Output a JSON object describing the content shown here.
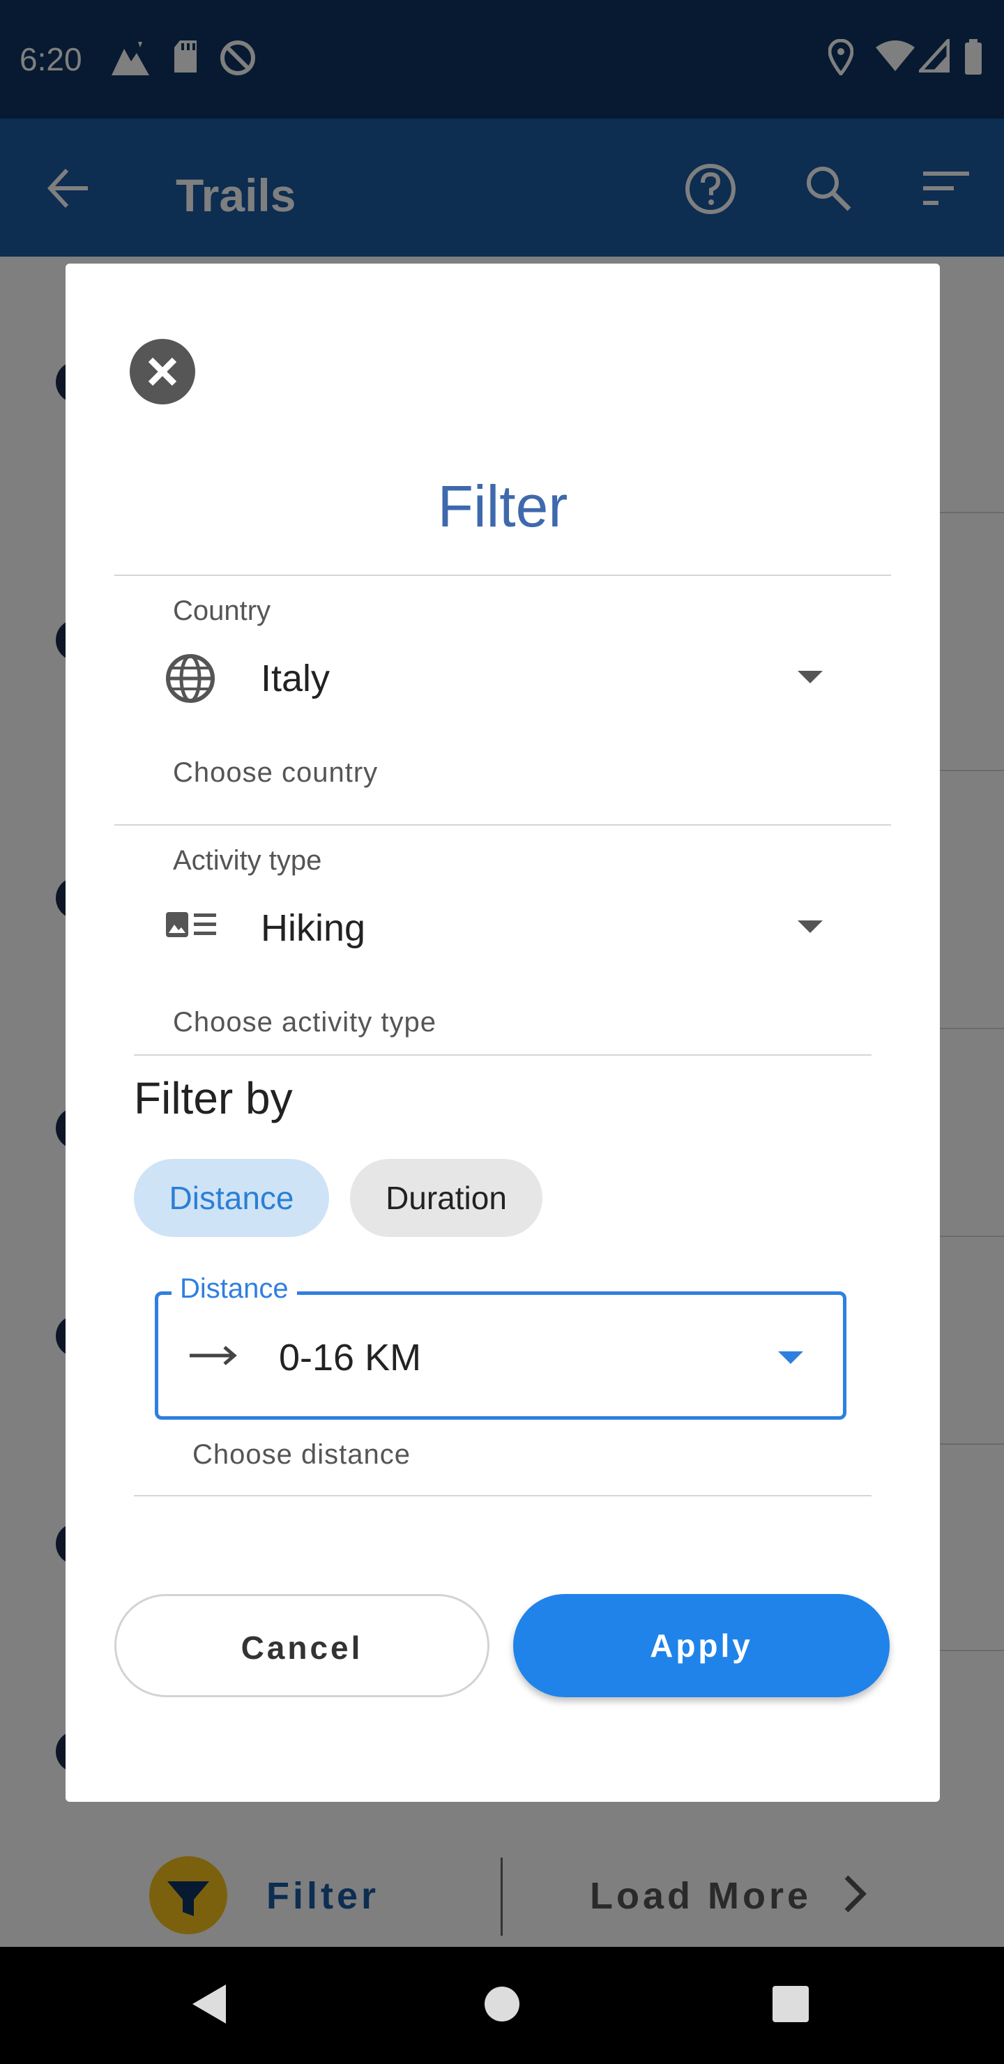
{
  "status_bar": {
    "time": "6:20"
  },
  "app_bar": {
    "title": "Trails"
  },
  "bottom_bar": {
    "filter_label": "Filter",
    "load_more_label": "Load More"
  },
  "dialog": {
    "title": "Filter",
    "country": {
      "label": "Country",
      "value": "Italy",
      "helper": "Choose country"
    },
    "activity": {
      "label": "Activity type",
      "value": "Hiking",
      "helper": "Choose activity type"
    },
    "filter_by": {
      "title": "Filter by",
      "chips": [
        "Distance",
        "Duration"
      ],
      "selected": "Distance"
    },
    "distance": {
      "label": "Distance",
      "value": "0-16 KM",
      "helper": "Choose distance"
    },
    "buttons": {
      "cancel": "Cancel",
      "apply": "Apply"
    }
  },
  "colors": {
    "status_bar": "#0f3562",
    "app_bar": "#1a5aa3",
    "accent": "#1f83ea",
    "title": "#3f69ad"
  }
}
